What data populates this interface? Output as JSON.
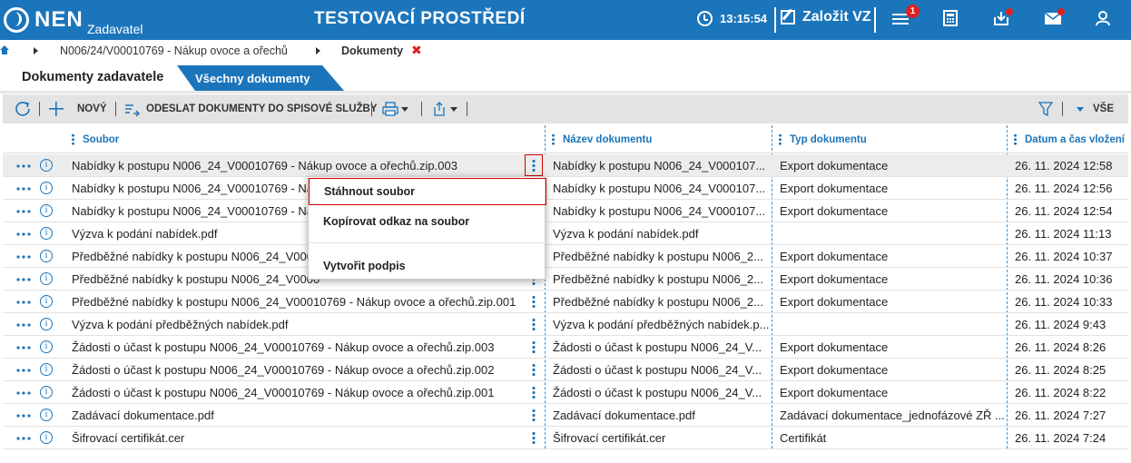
{
  "header": {
    "logo_name": "NEN",
    "logo_sub": "Zadavatel",
    "environment": "TESTOVACÍ PROSTŘEDÍ",
    "time": "13:15:54",
    "new_vz": "Založit VZ",
    "notification_count": "1",
    "accent_color": "#1b75bb"
  },
  "breadcrumb": {
    "items": [
      "N006/24/V00010769 - Nákup ovoce a ořechů",
      "Dokumenty"
    ],
    "close": "✖"
  },
  "tabs": [
    {
      "label": "Dokumenty zadavatele",
      "active": true
    },
    {
      "label": "Všechny dokumenty",
      "active": false
    }
  ],
  "toolbar": {
    "new_label": "NOVÝ",
    "send_label": "ODESLAT DOKUMENTY DO SPISOVÉ SLUŽBY",
    "filter_label": "VŠE"
  },
  "columns": [
    "Soubor",
    "Název dokumentu",
    "Typ dokumentu",
    "Datum a čas vložení"
  ],
  "rows": [
    {
      "soubor": "Nabídky k postupu N006_24_V00010769 - Nákup ovoce a ořechů.zip.003",
      "nazev": "Nabídky k postupu N006_24_V000107...",
      "typ": "Export dokumentace",
      "datum": "26. 11. 2024 12:58"
    },
    {
      "soubor": "Nabídky k postupu N006_24_V00010769 - Ná",
      "nazev": "Nabídky k postupu N006_24_V000107...",
      "typ": "Export dokumentace",
      "datum": "26. 11. 2024 12:56"
    },
    {
      "soubor": "Nabídky k postupu N006_24_V00010769 - Ná",
      "nazev": "Nabídky k postupu N006_24_V000107...",
      "typ": "Export dokumentace",
      "datum": "26. 11. 2024 12:54"
    },
    {
      "soubor": "Výzva k podání nabídek.pdf",
      "nazev": "Výzva k podání nabídek.pdf",
      "typ": "",
      "datum": "26. 11. 2024 11:13"
    },
    {
      "soubor": "Předběžné nabídky k postupu N006_24_V000",
      "nazev": "Předběžné nabídky k postupu N006_2...",
      "typ": "Export dokumentace",
      "datum": "26. 11. 2024 10:37"
    },
    {
      "soubor": "Předběžné nabídky k postupu N006_24_V0000",
      "nazev": "Předběžné nabídky k postupu N006_2...",
      "typ": "Export dokumentace",
      "datum": "26. 11. 2024 10:36"
    },
    {
      "soubor": "Předběžné nabídky k postupu N006_24_V00010769 - Nákup ovoce a ořechů.zip.001",
      "nazev": "Předběžné nabídky k postupu N006_2...",
      "typ": "Export dokumentace",
      "datum": "26. 11. 2024 10:33"
    },
    {
      "soubor": "Výzva k podání předběžných nabídek.pdf",
      "nazev": "Výzva k podání předběžných nabídek.p...",
      "typ": "",
      "datum": "26. 11. 2024 9:43"
    },
    {
      "soubor": "Žádosti o účast k postupu N006_24_V00010769 - Nákup ovoce a ořechů.zip.003",
      "nazev": "Žádosti o účast k postupu N006_24_V...",
      "typ": "Export dokumentace",
      "datum": "26. 11. 2024 8:26"
    },
    {
      "soubor": "Žádosti o účast k postupu N006_24_V00010769 - Nákup ovoce a ořechů.zip.002",
      "nazev": "Žádosti o účast k postupu N006_24_V...",
      "typ": "Export dokumentace",
      "datum": "26. 11. 2024 8:25"
    },
    {
      "soubor": "Žádosti o účast k postupu N006_24_V00010769 - Nákup ovoce a ořechů.zip.001",
      "nazev": "Žádosti o účast k postupu N006_24_V...",
      "typ": "Export dokumentace",
      "datum": "26. 11. 2024 8:22"
    },
    {
      "soubor": "Zadávací dokumentace.pdf",
      "nazev": "Zadávací dokumentace.pdf",
      "typ": "Zadávací dokumentace_jednofázové ZŘ ...",
      "datum": "26. 11. 2024 7:27"
    },
    {
      "soubor": "Šifrovací certifikát.cer",
      "nazev": "Šifrovací certifikát.cer",
      "typ": "Certifikát",
      "datum": "26. 11. 2024 7:24"
    }
  ],
  "context_menu": {
    "items": [
      "Stáhnout soubor",
      "Kopírovat odkaz na soubor",
      "Vytvořit podpis"
    ]
  }
}
